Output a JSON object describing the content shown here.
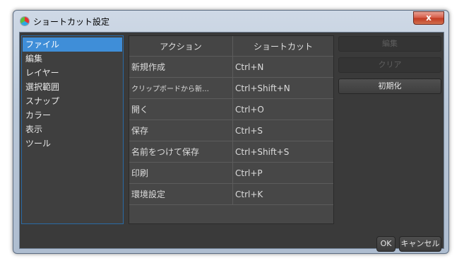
{
  "window": {
    "title": "ショートカット設定",
    "close_label": "x"
  },
  "categories": [
    {
      "label": "ファイル",
      "selected": true
    },
    {
      "label": "編集",
      "selected": false
    },
    {
      "label": "レイヤー",
      "selected": false
    },
    {
      "label": "選択範囲",
      "selected": false
    },
    {
      "label": "スナップ",
      "selected": false
    },
    {
      "label": "カラー",
      "selected": false
    },
    {
      "label": "表示",
      "selected": false
    },
    {
      "label": "ツール",
      "selected": false
    }
  ],
  "table": {
    "headers": {
      "action": "アクション",
      "shortcut": "ショートカット"
    },
    "rows": [
      {
        "action": "新規作成",
        "shortcut": "Ctrl+N"
      },
      {
        "action": "クリップボードから新…",
        "shortcut": "Ctrl+Shift+N"
      },
      {
        "action": "開く",
        "shortcut": "Ctrl+O"
      },
      {
        "action": "保存",
        "shortcut": "Ctrl+S"
      },
      {
        "action": "名前をつけて保存",
        "shortcut": "Ctrl+Shift+S"
      },
      {
        "action": "印刷",
        "shortcut": "Ctrl+P"
      },
      {
        "action": "環境設定",
        "shortcut": "Ctrl+K"
      }
    ]
  },
  "buttons": {
    "edit": "編集",
    "clear": "クリア",
    "reset": "初期化",
    "ok": "OK",
    "cancel": "キャンセル"
  },
  "colors": {
    "selection": "#3f8ed8",
    "background": "#3a3a3a"
  }
}
